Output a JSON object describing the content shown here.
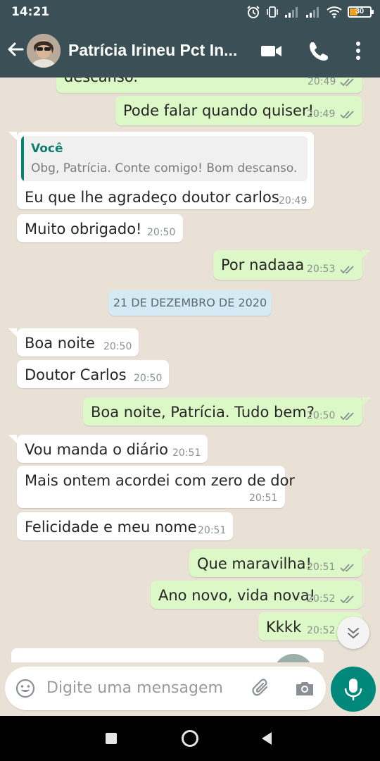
{
  "status_bar": {
    "time": "14:21",
    "battery": "30"
  },
  "header": {
    "contact_name": "Patrícia Irineu Pct In..."
  },
  "messages": [
    {
      "dir": "out",
      "text": "descanso.",
      "time": "20:49"
    },
    {
      "dir": "out",
      "text": "Pode falar quando quiser!",
      "time": "20:49"
    },
    {
      "dir": "in",
      "quoted_author": "Você",
      "quoted_text": "Obg, Patrícia. Conte comigo! Bom descanso.",
      "text": "Eu que lhe agradeço doutor carlos",
      "time": "20:49"
    },
    {
      "dir": "in",
      "text": "Muito obrigado!",
      "time": "20:50"
    },
    {
      "dir": "out",
      "text": "Por nadaaa",
      "time": "20:53"
    },
    {
      "dir": "in",
      "text": "Boa noite",
      "time": "20:50"
    },
    {
      "dir": "in",
      "text": "Doutor Carlos",
      "time": "20:50"
    },
    {
      "dir": "out",
      "text": "Boa noite, Patrícia. Tudo bem?",
      "time": "20:50"
    },
    {
      "dir": "in",
      "text": "Vou manda o diário",
      "time": "20:51"
    },
    {
      "dir": "in",
      "text": "Mais ontem acordei com zero de dor",
      "time": "20:51"
    },
    {
      "dir": "in",
      "text": "Felicidade e meu nome",
      "time": "20:51"
    },
    {
      "dir": "out",
      "text": "Que maravilha!",
      "time": "20:51"
    },
    {
      "dir": "out",
      "text": "Ano novo, vida nova!",
      "time": "20:52"
    },
    {
      "dir": "out",
      "text": "Kkkk",
      "time": "20:52"
    }
  ],
  "date_separator": "21 DE DEZEMBRO DE 2020",
  "composer": {
    "placeholder": "Digite uma mensagem"
  },
  "colors": {
    "header": "#3b4f56",
    "outgoing_bubble": "#dcf8c6",
    "incoming_bubble": "#ffffff",
    "accent": "#00897b",
    "chat_background": "#e9e1d6",
    "read_ticks": "#8a8f92"
  }
}
